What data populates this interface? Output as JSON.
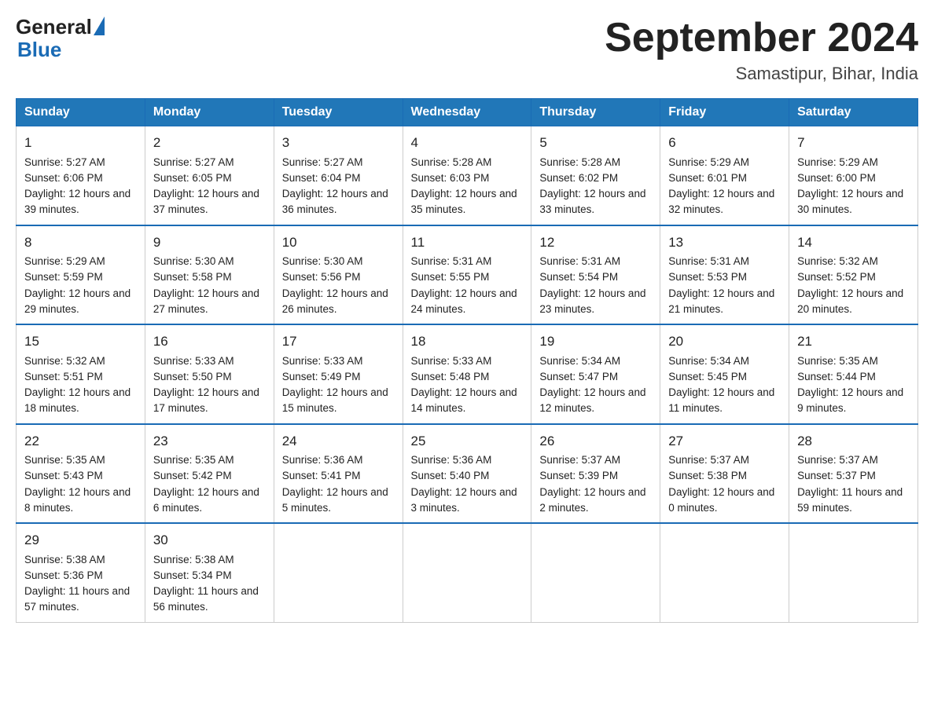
{
  "header": {
    "logo_general": "General",
    "logo_blue": "Blue",
    "month_title": "September 2024",
    "subtitle": "Samastipur, Bihar, India"
  },
  "days_of_week": [
    "Sunday",
    "Monday",
    "Tuesday",
    "Wednesday",
    "Thursday",
    "Friday",
    "Saturday"
  ],
  "weeks": [
    [
      {
        "day": "1",
        "sunrise": "5:27 AM",
        "sunset": "6:06 PM",
        "daylight": "12 hours and 39 minutes."
      },
      {
        "day": "2",
        "sunrise": "5:27 AM",
        "sunset": "6:05 PM",
        "daylight": "12 hours and 37 minutes."
      },
      {
        "day": "3",
        "sunrise": "5:27 AM",
        "sunset": "6:04 PM",
        "daylight": "12 hours and 36 minutes."
      },
      {
        "day": "4",
        "sunrise": "5:28 AM",
        "sunset": "6:03 PM",
        "daylight": "12 hours and 35 minutes."
      },
      {
        "day": "5",
        "sunrise": "5:28 AM",
        "sunset": "6:02 PM",
        "daylight": "12 hours and 33 minutes."
      },
      {
        "day": "6",
        "sunrise": "5:29 AM",
        "sunset": "6:01 PM",
        "daylight": "12 hours and 32 minutes."
      },
      {
        "day": "7",
        "sunrise": "5:29 AM",
        "sunset": "6:00 PM",
        "daylight": "12 hours and 30 minutes."
      }
    ],
    [
      {
        "day": "8",
        "sunrise": "5:29 AM",
        "sunset": "5:59 PM",
        "daylight": "12 hours and 29 minutes."
      },
      {
        "day": "9",
        "sunrise": "5:30 AM",
        "sunset": "5:58 PM",
        "daylight": "12 hours and 27 minutes."
      },
      {
        "day": "10",
        "sunrise": "5:30 AM",
        "sunset": "5:56 PM",
        "daylight": "12 hours and 26 minutes."
      },
      {
        "day": "11",
        "sunrise": "5:31 AM",
        "sunset": "5:55 PM",
        "daylight": "12 hours and 24 minutes."
      },
      {
        "day": "12",
        "sunrise": "5:31 AM",
        "sunset": "5:54 PM",
        "daylight": "12 hours and 23 minutes."
      },
      {
        "day": "13",
        "sunrise": "5:31 AM",
        "sunset": "5:53 PM",
        "daylight": "12 hours and 21 minutes."
      },
      {
        "day": "14",
        "sunrise": "5:32 AM",
        "sunset": "5:52 PM",
        "daylight": "12 hours and 20 minutes."
      }
    ],
    [
      {
        "day": "15",
        "sunrise": "5:32 AM",
        "sunset": "5:51 PM",
        "daylight": "12 hours and 18 minutes."
      },
      {
        "day": "16",
        "sunrise": "5:33 AM",
        "sunset": "5:50 PM",
        "daylight": "12 hours and 17 minutes."
      },
      {
        "day": "17",
        "sunrise": "5:33 AM",
        "sunset": "5:49 PM",
        "daylight": "12 hours and 15 minutes."
      },
      {
        "day": "18",
        "sunrise": "5:33 AM",
        "sunset": "5:48 PM",
        "daylight": "12 hours and 14 minutes."
      },
      {
        "day": "19",
        "sunrise": "5:34 AM",
        "sunset": "5:47 PM",
        "daylight": "12 hours and 12 minutes."
      },
      {
        "day": "20",
        "sunrise": "5:34 AM",
        "sunset": "5:45 PM",
        "daylight": "12 hours and 11 minutes."
      },
      {
        "day": "21",
        "sunrise": "5:35 AM",
        "sunset": "5:44 PM",
        "daylight": "12 hours and 9 minutes."
      }
    ],
    [
      {
        "day": "22",
        "sunrise": "5:35 AM",
        "sunset": "5:43 PM",
        "daylight": "12 hours and 8 minutes."
      },
      {
        "day": "23",
        "sunrise": "5:35 AM",
        "sunset": "5:42 PM",
        "daylight": "12 hours and 6 minutes."
      },
      {
        "day": "24",
        "sunrise": "5:36 AM",
        "sunset": "5:41 PM",
        "daylight": "12 hours and 5 minutes."
      },
      {
        "day": "25",
        "sunrise": "5:36 AM",
        "sunset": "5:40 PM",
        "daylight": "12 hours and 3 minutes."
      },
      {
        "day": "26",
        "sunrise": "5:37 AM",
        "sunset": "5:39 PM",
        "daylight": "12 hours and 2 minutes."
      },
      {
        "day": "27",
        "sunrise": "5:37 AM",
        "sunset": "5:38 PM",
        "daylight": "12 hours and 0 minutes."
      },
      {
        "day": "28",
        "sunrise": "5:37 AM",
        "sunset": "5:37 PM",
        "daylight": "11 hours and 59 minutes."
      }
    ],
    [
      {
        "day": "29",
        "sunrise": "5:38 AM",
        "sunset": "5:36 PM",
        "daylight": "11 hours and 57 minutes."
      },
      {
        "day": "30",
        "sunrise": "5:38 AM",
        "sunset": "5:34 PM",
        "daylight": "11 hours and 56 minutes."
      },
      {
        "day": "",
        "sunrise": "",
        "sunset": "",
        "daylight": ""
      },
      {
        "day": "",
        "sunrise": "",
        "sunset": "",
        "daylight": ""
      },
      {
        "day": "",
        "sunrise": "",
        "sunset": "",
        "daylight": ""
      },
      {
        "day": "",
        "sunrise": "",
        "sunset": "",
        "daylight": ""
      },
      {
        "day": "",
        "sunrise": "",
        "sunset": "",
        "daylight": ""
      }
    ]
  ],
  "labels": {
    "sunrise_prefix": "Sunrise: ",
    "sunset_prefix": "Sunset: ",
    "daylight_prefix": "Daylight: "
  }
}
